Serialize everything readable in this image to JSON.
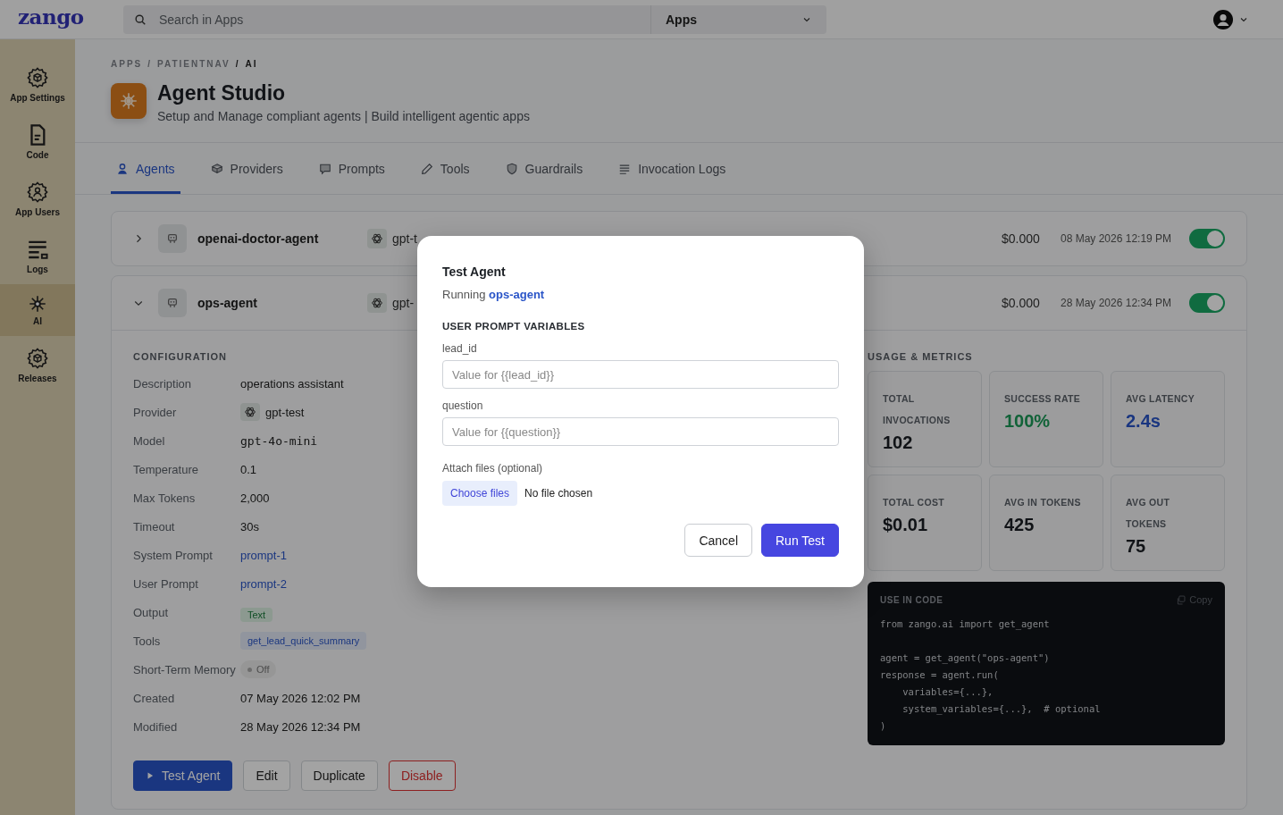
{
  "topbar": {
    "logo": "zango",
    "search": {
      "placeholder": "Search in Apps"
    },
    "app_select": "Apps"
  },
  "sidebar": {
    "items": [
      {
        "label": "App Settings",
        "selected": false
      },
      {
        "label": "Code",
        "selected": false
      },
      {
        "label": "App Users",
        "selected": false
      },
      {
        "label": "Logs",
        "selected": false
      },
      {
        "label": "AI",
        "selected": true
      },
      {
        "label": "Releases",
        "selected": false
      }
    ]
  },
  "breadcrumb": {
    "separator": "/",
    "items": [
      "APPS",
      "PATIENTNAV",
      "AI"
    ]
  },
  "header": {
    "title": "Agent Studio",
    "subtitle": "Setup and Manage compliant agents | Build intelligent agentic apps"
  },
  "tabs": [
    {
      "label": "Agents",
      "selected": true
    },
    {
      "label": "Providers",
      "selected": false
    },
    {
      "label": "Prompts",
      "selected": false
    },
    {
      "label": "Tools",
      "selected": false
    },
    {
      "label": "Guardrails",
      "selected": false
    },
    {
      "label": "Invocation Logs",
      "selected": false
    }
  ],
  "agents": [
    {
      "name": "openai-doctor-agent",
      "expanded": false,
      "provider": "gpt-t",
      "cost": "$0.000",
      "modified": "08 May 2026 12:19 PM",
      "enabled": true
    },
    {
      "name": "ops-agent",
      "expanded": true,
      "provider": "gpt-",
      "cost": "$0.000",
      "modified": "28 May 2026 12:34 PM",
      "enabled": true
    }
  ],
  "configuration": {
    "title": "CONFIGURATION",
    "rows": [
      {
        "label": "Description",
        "value": "operations assistant",
        "kind": "text"
      },
      {
        "label": "Provider",
        "value": "gpt-test",
        "kind": "provider"
      },
      {
        "label": "Model",
        "value": "gpt-4o-mini",
        "kind": "mono"
      },
      {
        "label": "Temperature",
        "value": "0.1",
        "kind": "text"
      },
      {
        "label": "Max Tokens",
        "value": "2,000",
        "kind": "text"
      },
      {
        "label": "Timeout",
        "value": "30s",
        "kind": "text"
      },
      {
        "label": "System Prompt",
        "value": "prompt-1",
        "kind": "link"
      },
      {
        "label": "User Prompt",
        "value": "prompt-2",
        "kind": "link"
      },
      {
        "label": "Output",
        "value": "Text",
        "kind": "badge"
      },
      {
        "label": "Tools",
        "value": "get_lead_quick_summary",
        "kind": "tag"
      },
      {
        "label": "Short-Term Memory",
        "value": "Off",
        "kind": "status",
        "on": false
      },
      {
        "label": "Created",
        "value": "07 May 2026 12:02 PM",
        "kind": "text"
      },
      {
        "label": "Modified",
        "value": "28 May 2026 12:34 PM",
        "kind": "text"
      }
    ]
  },
  "actions": [
    {
      "label": "Test Agent",
      "kind": "primary"
    },
    {
      "label": "Edit",
      "kind": "default"
    },
    {
      "label": "Duplicate",
      "kind": "default"
    },
    {
      "label": "Disable",
      "kind": "danger"
    }
  ],
  "metrics": {
    "title": "USAGE & METRICS",
    "cards": [
      {
        "label": "TOTAL INVOCATIONS",
        "value": "102",
        "kind": "plain"
      },
      {
        "label": "SUCCESS RATE",
        "value": "100%",
        "kind": "success"
      },
      {
        "label": "AVG LATENCY",
        "value": "2.4s",
        "kind": "info"
      },
      {
        "label": "TOTAL COST",
        "value": "$0.01",
        "kind": "plain"
      },
      {
        "label": "AVG IN TOKENS",
        "value": "425",
        "kind": "plain"
      },
      {
        "label": "AVG OUT TOKENS",
        "value": "75",
        "kind": "plain"
      }
    ]
  },
  "code": {
    "title": "USE IN CODE",
    "copy": "Copy",
    "text": "from zango.ai import get_agent\n\nagent = get_agent(\"ops-agent\")\nresponse = agent.run(\n    variables={...},\n    system_variables={...},  # optional\n)"
  },
  "dialog": {
    "title": "Test Agent",
    "subtitle": "Running **ops-agent**",
    "section": "USER PROMPT VARIABLES",
    "fields": [
      {
        "label": "lead_id",
        "placeholder": "Value for {{lead_id}}"
      },
      {
        "label": "question",
        "placeholder": "Value for {{question}}"
      }
    ],
    "attach": {
      "label": "Attach files (optional)",
      "button": "Choose files",
      "status": "No file chosen"
    },
    "buttons": [
      {
        "label": "Cancel",
        "kind": "default"
      },
      {
        "label": "Run Test",
        "kind": "primary"
      }
    ]
  }
}
